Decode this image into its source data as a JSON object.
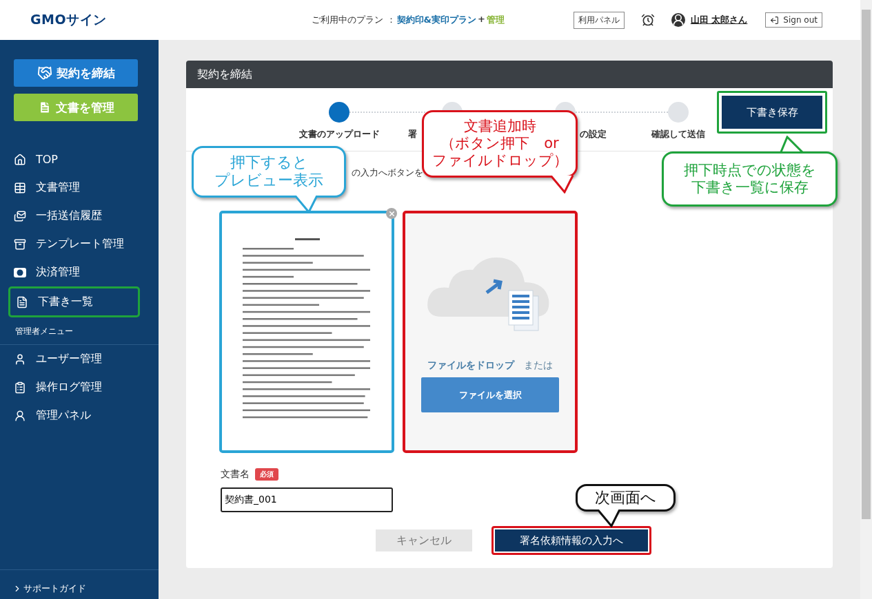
{
  "header": {
    "logo": "GMOサイン",
    "plan_label": "ご利用中のプラン ：",
    "plan_name": "契約印&実印プラン",
    "plan_plus": "+",
    "plan_extra": "管理",
    "panel_button": "利用パネル",
    "user_name": "山田 太郎さん",
    "sign_out": "Sign out"
  },
  "sidebar": {
    "actions": [
      {
        "kind": "contract",
        "label": "契約を締結"
      },
      {
        "kind": "manage",
        "label": "文書を管理"
      }
    ],
    "items": [
      {
        "label": "TOP",
        "highlighted": false
      },
      {
        "label": "文書管理",
        "highlighted": false
      },
      {
        "label": "一括送信履歴",
        "highlighted": false
      },
      {
        "label": "テンプレート管理",
        "highlighted": false
      },
      {
        "label": "決済管理",
        "highlighted": false
      },
      {
        "label": "下書き一覧",
        "highlighted": true
      }
    ],
    "admin_heading": "管理者メニュー",
    "admin_items": [
      {
        "label": "ユーザー管理"
      },
      {
        "label": "操作ログ管理"
      },
      {
        "label": "管理パネル"
      }
    ],
    "footer": "サポートガイド"
  },
  "card": {
    "title": "契約を締結",
    "steps": [
      {
        "label": "文書のアップロード",
        "selected": true
      },
      {
        "label": "署",
        "selected": false
      },
      {
        "label": "の設定",
        "selected": false
      },
      {
        "label": "確認して送信",
        "selected": false
      }
    ],
    "save_button": {
      "label": "下書き保存",
      "highlighted": true
    },
    "instruction": "の入力へボタンを",
    "upload": {
      "drop_text": "ファイルをドロップ",
      "or_text": "または",
      "select_button": "ファイルを選択",
      "highlighted": true
    },
    "preview": {
      "highlighted": true
    },
    "doc_name": {
      "label": "文書名",
      "required": "必須",
      "value": "契約書_001"
    },
    "cancel": "キャンセル",
    "next": {
      "label": "署名依頼情報の入力へ",
      "highlighted": true
    }
  },
  "callouts": [
    {
      "kind": "preview",
      "color": "#2aa5d6",
      "lines": [
        "押下すると",
        "プレビュー表示"
      ]
    },
    {
      "kind": "upload",
      "color": "#d9121b",
      "lines": [
        "文書追加時",
        "（ボタン押下　or",
        "ファイルドロップ）"
      ]
    },
    {
      "kind": "save",
      "color": "#1fa33c",
      "lines": [
        "押下時点での状態を",
        "下書き一覧に保存"
      ]
    },
    {
      "kind": "next",
      "color": "#111111",
      "lines": [
        "次画面へ"
      ]
    }
  ]
}
